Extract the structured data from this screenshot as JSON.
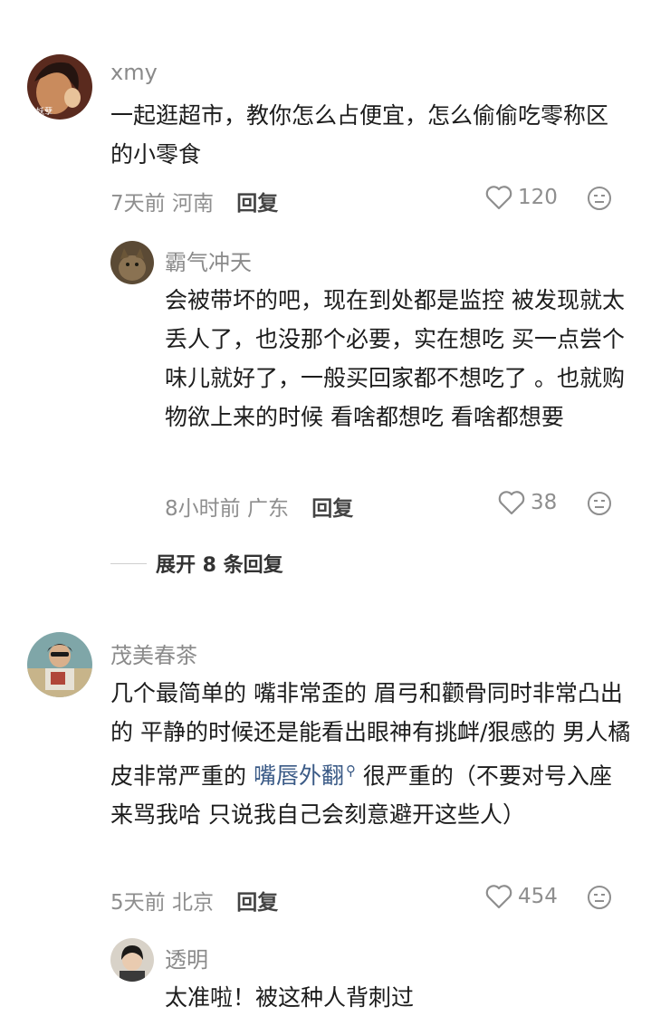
{
  "comments": [
    {
      "username": "xmy",
      "avatar_caption": "妖孽",
      "text": "一起逛超市，教你怎么占便宜，怎么偷偷吃零称区的小零食",
      "time": "7天前",
      "location": "河南",
      "reply_label": "回复",
      "likes": "120",
      "replies": [
        {
          "username": "霸气冲天",
          "text": "会被带坏的吧，现在到处都是监控 被发现就太丢人了，也没那个必要，实在想吃 买一点尝个味儿就好了，一般买回家都不想吃了 。也就购物欲上来的时候 看啥都想吃 看啥都想要",
          "time": "8小时前",
          "location": "广东",
          "reply_label": "回复",
          "likes": "38"
        }
      ],
      "expand_label": "展开 8 条回复"
    },
    {
      "username": "茂美春茶",
      "text_before_link": "几个最简单的 嘴非常歪的 眉弓和颧骨同时非常凸出的 平静的时候还是能看出眼神有挑衅/狠感的 男人橘皮非常严重的 ",
      "link_text": "嘴唇外翻",
      "text_after_link": " 很严重的（不要对号入座来骂我哈 只说我自己会刻意避开这些人）",
      "time": "5天前",
      "location": "北京",
      "reply_label": "回复",
      "likes": "454",
      "replies": [
        {
          "username": "透明",
          "text": "太准啦！被这种人背刺过"
        }
      ]
    }
  ],
  "icons": {
    "like": "heart-outline-icon",
    "emoji": "emoji-face-icon",
    "link": "search-link-icon"
  },
  "colors": {
    "username": "#8a8a8a",
    "text": "#1c1c1c",
    "link": "#3a5a86",
    "meta": "#8e8e8e"
  }
}
